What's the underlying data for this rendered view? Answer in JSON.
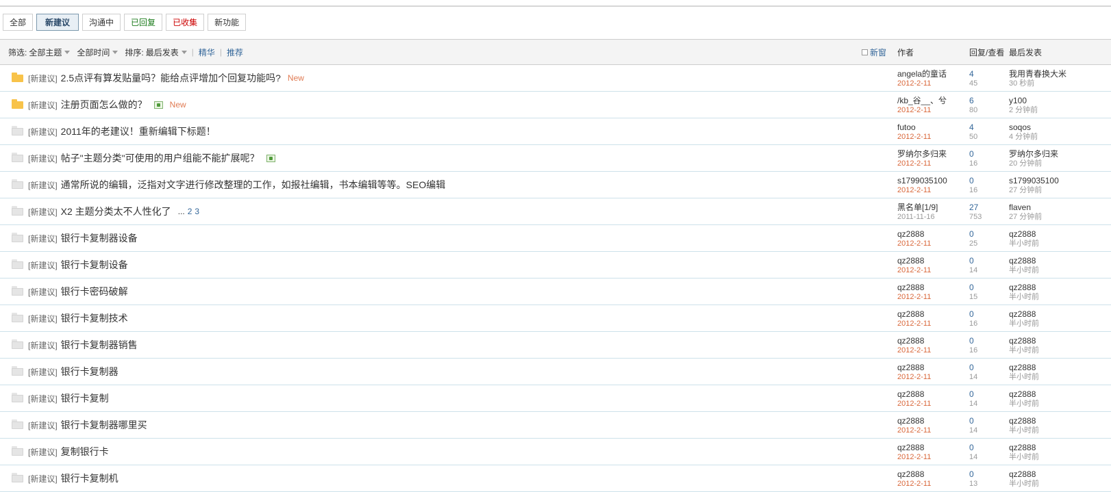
{
  "type_tabs": [
    {
      "label": "全部",
      "style": "normal"
    },
    {
      "label": "新建议",
      "style": "active"
    },
    {
      "label": "沟通中",
      "style": "normal"
    },
    {
      "label": "已回复",
      "style": "green"
    },
    {
      "label": "已收集",
      "style": "red"
    },
    {
      "label": "新功能",
      "style": "normal"
    }
  ],
  "filter_bar": {
    "filter_label": "筛选:",
    "topic_filter": "全部主题",
    "time_filter": "全部时间",
    "sort_label": "排序:",
    "sort_value": "最后发表",
    "digest_link": "精华",
    "recommend_link": "推荐",
    "new_window_label": "新窗",
    "col_author": "作者",
    "col_replies_views": "回复/查看",
    "col_last_post": "最后发表"
  },
  "threads": [
    {
      "icon": "folder-new-icon",
      "prefix": "[新建议]",
      "subject": "2.5点评有算发贴量吗？能给点评增加个回复功能吗?",
      "new_tag": "New",
      "has_image": false,
      "pages": [],
      "author": "angela的童话",
      "date": "2012-2-11",
      "date_old": false,
      "replies": "4",
      "views": "45",
      "last_user": "我用青春换大米",
      "last_time": "30 秒前"
    },
    {
      "icon": "folder-new-icon",
      "prefix": "[新建议]",
      "subject": "注册页面怎么做的？",
      "new_tag": "New",
      "has_image": true,
      "pages": [],
      "author": "/kb_谷__、兮",
      "date": "2012-2-11",
      "date_old": false,
      "replies": "6",
      "views": "80",
      "last_user": "y100",
      "last_time": "2 分钟前"
    },
    {
      "icon": "folder-common-icon",
      "prefix": "[新建议]",
      "subject": "2011年的老建议！重新编辑下标题！",
      "new_tag": "",
      "has_image": false,
      "pages": [],
      "author": "futoo",
      "date": "2012-2-11",
      "date_old": false,
      "replies": "4",
      "views": "50",
      "last_user": "soqos",
      "last_time": "4 分钟前"
    },
    {
      "icon": "folder-common-icon",
      "prefix": "[新建议]",
      "subject": "帖子\"主题分类\"可使用的用户组能不能扩展呢？",
      "new_tag": "",
      "has_image": true,
      "pages": [],
      "author": "罗纳尔多归来",
      "date": "2012-2-11",
      "date_old": false,
      "replies": "0",
      "views": "16",
      "last_user": "罗纳尔多归来",
      "last_time": "20 分钟前"
    },
    {
      "icon": "folder-common-icon",
      "prefix": "[新建议]",
      "subject": "通常所说的编辑，泛指对文字进行修改整理的工作，如报社编辑，书本编辑等等。SEO编辑",
      "new_tag": "",
      "has_image": false,
      "pages": [],
      "author": "s1799035100",
      "date": "2012-2-11",
      "date_old": false,
      "replies": "0",
      "views": "16",
      "last_user": "s1799035100",
      "last_time": "27 分钟前"
    },
    {
      "icon": "folder-common-icon",
      "prefix": "[新建议]",
      "subject": "X2 主题分类太不人性化了",
      "new_tag": "",
      "has_image": false,
      "pages": [
        "...",
        "2",
        "3"
      ],
      "author": "黑名单[1/9]",
      "date": "2011-11-16",
      "date_old": true,
      "replies": "27",
      "views": "753",
      "last_user": "flaven",
      "last_time": "27 分钟前"
    },
    {
      "icon": "folder-common-icon",
      "prefix": "[新建议]",
      "subject": "银行卡复制器设备",
      "new_tag": "",
      "has_image": false,
      "pages": [],
      "author": "qz2888",
      "date": "2012-2-11",
      "date_old": false,
      "replies": "0",
      "views": "25",
      "last_user": "qz2888",
      "last_time": "半小时前"
    },
    {
      "icon": "folder-common-icon",
      "prefix": "[新建议]",
      "subject": "银行卡复制设备",
      "new_tag": "",
      "has_image": false,
      "pages": [],
      "author": "qz2888",
      "date": "2012-2-11",
      "date_old": false,
      "replies": "0",
      "views": "14",
      "last_user": "qz2888",
      "last_time": "半小时前"
    },
    {
      "icon": "folder-common-icon",
      "prefix": "[新建议]",
      "subject": "银行卡密码破解",
      "new_tag": "",
      "has_image": false,
      "pages": [],
      "author": "qz2888",
      "date": "2012-2-11",
      "date_old": false,
      "replies": "0",
      "views": "15",
      "last_user": "qz2888",
      "last_time": "半小时前"
    },
    {
      "icon": "folder-common-icon",
      "prefix": "[新建议]",
      "subject": "银行卡复制技术",
      "new_tag": "",
      "has_image": false,
      "pages": [],
      "author": "qz2888",
      "date": "2012-2-11",
      "date_old": false,
      "replies": "0",
      "views": "16",
      "last_user": "qz2888",
      "last_time": "半小时前"
    },
    {
      "icon": "folder-common-icon",
      "prefix": "[新建议]",
      "subject": "银行卡复制器销售",
      "new_tag": "",
      "has_image": false,
      "pages": [],
      "author": "qz2888",
      "date": "2012-2-11",
      "date_old": false,
      "replies": "0",
      "views": "16",
      "last_user": "qz2888",
      "last_time": "半小时前"
    },
    {
      "icon": "folder-common-icon",
      "prefix": "[新建议]",
      "subject": "银行卡复制器",
      "new_tag": "",
      "has_image": false,
      "pages": [],
      "author": "qz2888",
      "date": "2012-2-11",
      "date_old": false,
      "replies": "0",
      "views": "14",
      "last_user": "qz2888",
      "last_time": "半小时前"
    },
    {
      "icon": "folder-common-icon",
      "prefix": "[新建议]",
      "subject": "银行卡复制",
      "new_tag": "",
      "has_image": false,
      "pages": [],
      "author": "qz2888",
      "date": "2012-2-11",
      "date_old": false,
      "replies": "0",
      "views": "14",
      "last_user": "qz2888",
      "last_time": "半小时前"
    },
    {
      "icon": "folder-common-icon",
      "prefix": "[新建议]",
      "subject": "银行卡复制器哪里买",
      "new_tag": "",
      "has_image": false,
      "pages": [],
      "author": "qz2888",
      "date": "2012-2-11",
      "date_old": false,
      "replies": "0",
      "views": "14",
      "last_user": "qz2888",
      "last_time": "半小时前"
    },
    {
      "icon": "folder-common-icon",
      "prefix": "[新建议]",
      "subject": "复制银行卡",
      "new_tag": "",
      "has_image": false,
      "pages": [],
      "author": "qz2888",
      "date": "2012-2-11",
      "date_old": false,
      "replies": "0",
      "views": "14",
      "last_user": "qz2888",
      "last_time": "半小时前"
    },
    {
      "icon": "folder-common-icon",
      "prefix": "[新建议]",
      "subject": "银行卡复制机",
      "new_tag": "",
      "has_image": false,
      "pages": [],
      "author": "qz2888",
      "date": "2012-2-11",
      "date_old": false,
      "replies": "0",
      "views": "13",
      "last_user": "qz2888",
      "last_time": "半小时前"
    }
  ]
}
